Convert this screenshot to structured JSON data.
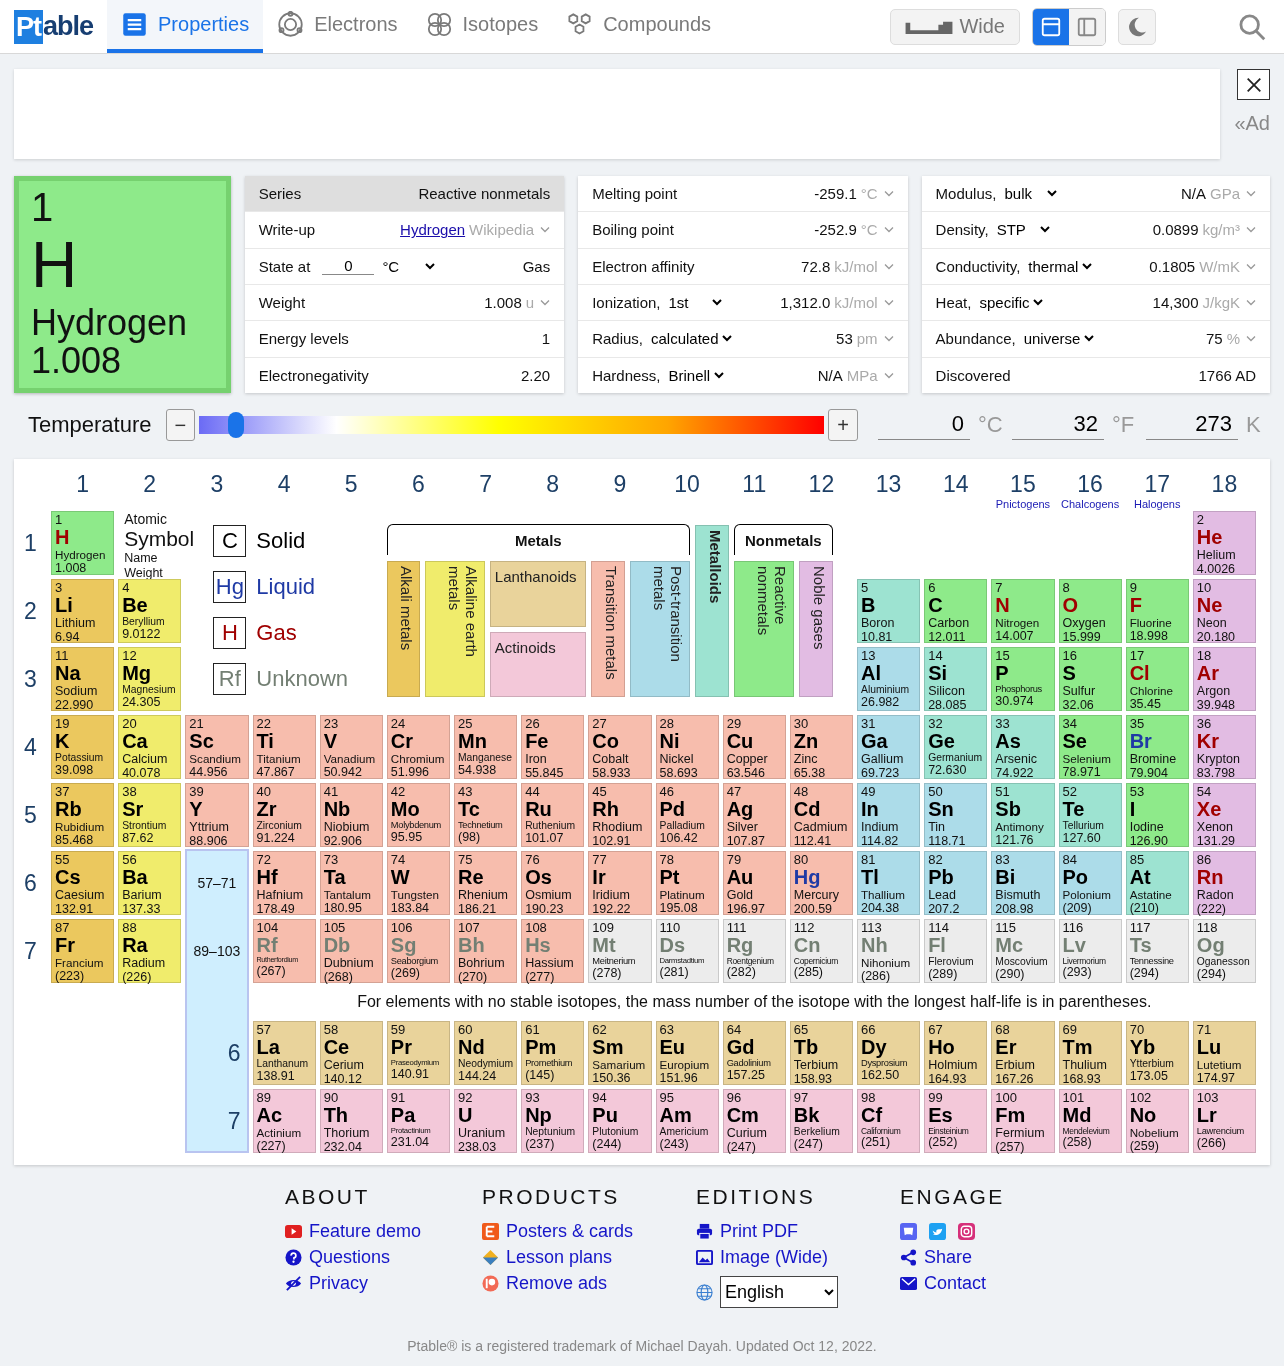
{
  "header": {
    "logo": {
      "mark": "Pt",
      "text": "able"
    },
    "tabs": [
      {
        "label": "Properties",
        "selected": true
      },
      {
        "label": "Electrons",
        "selected": false
      },
      {
        "label": "Isotopes",
        "selected": false
      },
      {
        "label": "Compounds",
        "selected": false
      }
    ],
    "wide_button": "Wide",
    "layouts": [
      {
        "selected": true
      },
      {
        "selected": false
      }
    ]
  },
  "ad": {
    "label": "«Ad"
  },
  "selected_element": {
    "number": "1",
    "symbol": "H",
    "name": "Hydrogen",
    "weight": "1.008",
    "kind": "reactive"
  },
  "property_tables": [
    {
      "rows": [
        {
          "label": "Series",
          "value": "Reactive nonmetals",
          "shaded": true,
          "menu": false
        },
        {
          "label": "Write-up",
          "link": "Hydrogen",
          "unit": "Wikipedia",
          "shaded": false,
          "menu": true
        },
        {
          "label": "State at",
          "input": "0",
          "select": "°C",
          "value": "Gas",
          "shaded": false,
          "menu": false
        },
        {
          "label": "Weight",
          "value": "1.008",
          "unit": "u",
          "shaded": false,
          "menu": true
        },
        {
          "label": "Energy levels",
          "value": "1",
          "shaded": false,
          "menu": false
        },
        {
          "label": "Electronegativity",
          "value": "2.20",
          "shaded": false,
          "menu": false
        }
      ]
    },
    {
      "rows": [
        {
          "label": "Melting point",
          "value": "-259.1",
          "unit": "°C",
          "shaded": false,
          "menu": true
        },
        {
          "label": "Boiling point",
          "value": "-252.9",
          "unit": "°C",
          "shaded": false,
          "menu": true
        },
        {
          "label": "Electron affinity",
          "value": "72.8",
          "unit": "kJ/mol",
          "shaded": false,
          "menu": true
        },
        {
          "label": "Ionization,",
          "select": "1st",
          "value": "1,312.0",
          "unit": "kJ/mol",
          "shaded": false,
          "menu": true
        },
        {
          "label": "Radius,",
          "select": "calculated",
          "value": "53",
          "unit": "pm",
          "shaded": false,
          "menu": true
        },
        {
          "label": "Hardness,",
          "select": "Brinell",
          "value": "N/A",
          "unit": "MPa",
          "shaded": false,
          "menu": true
        }
      ]
    },
    {
      "rows": [
        {
          "label": "Modulus,",
          "select": "bulk",
          "value": "N/A",
          "unit": "GPa",
          "shaded": false,
          "menu": true
        },
        {
          "label": "Density,",
          "select": "STP",
          "value": "0.0899",
          "unit": "kg/m³",
          "shaded": false,
          "menu": true
        },
        {
          "label": "Conductivity,",
          "select": "thermal",
          "value": "0.1805",
          "unit": "W/mK",
          "shaded": false,
          "menu": true
        },
        {
          "label": "Heat,",
          "select": "specific",
          "value": "14,300",
          "unit": "J/kgK",
          "shaded": false,
          "menu": true
        },
        {
          "label": "Abundance,",
          "select": "universe",
          "value": "75",
          "unit": "%",
          "shaded": false,
          "menu": true
        },
        {
          "label": "Discovered",
          "value": "1766 AD",
          "shaded": false,
          "menu": false
        }
      ]
    }
  ],
  "temperature": {
    "label": "Temperature",
    "minus": "−",
    "plus": "+",
    "level": 0.058,
    "readings": [
      {
        "value": "0",
        "unit": "°C"
      },
      {
        "value": "32",
        "unit": "°F"
      },
      {
        "value": "273",
        "unit": "K"
      }
    ]
  },
  "table": {
    "groups": [
      {
        "number": "1"
      },
      {
        "number": "2"
      },
      {
        "number": "3"
      },
      {
        "number": "4"
      },
      {
        "number": "5"
      },
      {
        "number": "6"
      },
      {
        "number": "7"
      },
      {
        "number": "8"
      },
      {
        "number": "9"
      },
      {
        "number": "10"
      },
      {
        "number": "11"
      },
      {
        "number": "12"
      },
      {
        "number": "13"
      },
      {
        "number": "14"
      },
      {
        "number": "15",
        "name": "Pnictogens"
      },
      {
        "number": "16",
        "name": "Chalcogens"
      },
      {
        "number": "17",
        "name": "Halogens"
      },
      {
        "number": "18"
      }
    ],
    "periods": [
      "1",
      "2",
      "3",
      "4",
      "5",
      "6",
      "7"
    ],
    "key": {
      "number": "Atomic",
      "symbol": "Symbol",
      "name": "Name",
      "weight": "Weight"
    },
    "states": [
      {
        "symbol": "C",
        "label": "Solid",
        "color": "#000000"
      },
      {
        "symbol": "Hg",
        "label": "Liquid",
        "color": "#1f3aa5"
      },
      {
        "symbol": "H",
        "label": "Gas",
        "color": "#a00000"
      },
      {
        "symbol": "Rf",
        "label": "Unknown",
        "color": "#737f73"
      }
    ],
    "legend": {
      "metals": {
        "label": "Metals",
        "categories": [
          {
            "kind": "alkali",
            "label": "Alkali metals"
          },
          {
            "kind": "alkaline",
            "label": "Alkaline earth metals"
          },
          {
            "kind": "stack",
            "items": [
              {
                "kind": "lanthanoid",
                "label": "Lanthanoids"
              },
              {
                "kind": "actinoid",
                "label": "Actinoids"
              }
            ]
          },
          {
            "kind": "transition",
            "label": "Transition metals"
          },
          {
            "kind": "post",
            "label": "Post-transition metals"
          }
        ]
      },
      "metalloids": {
        "kind": "metalloid",
        "label": "Metalloids"
      },
      "nonmetals": {
        "label": "Nonmetals",
        "categories": [
          {
            "kind": "reactive",
            "label": "Reactive nonmetals"
          },
          {
            "kind": "noble",
            "label": "Noble gases"
          }
        ]
      }
    },
    "f_block": {
      "ranges": [
        "57–71",
        "89–103"
      ],
      "periods": [
        "6",
        "7"
      ]
    },
    "note": "For elements with no stable isotopes, the mass number of the isotope with the longest half-life is in parentheses.",
    "elements": [
      {
        "number": "1",
        "symbol": "H",
        "name": "Hydrogen",
        "weight": "1.008",
        "kind": "reactive",
        "color": "#a00000"
      },
      {
        "number": "2",
        "symbol": "He",
        "name": "Helium",
        "weight": "4.0026",
        "kind": "noble",
        "color": "#a00000"
      },
      {
        "number": "3",
        "symbol": "Li",
        "name": "Lithium",
        "weight": "6.94",
        "kind": "alkali",
        "color": "#000000"
      },
      {
        "number": "4",
        "symbol": "Be",
        "name": "Beryllium",
        "weight": "9.0122",
        "kind": "alkaline",
        "color": "#000000"
      },
      {
        "number": "5",
        "symbol": "B",
        "name": "Boron",
        "weight": "10.81",
        "kind": "metalloid",
        "color": "#000000"
      },
      {
        "number": "6",
        "symbol": "C",
        "name": "Carbon",
        "weight": "12.011",
        "kind": "reactive",
        "color": "#000000"
      },
      {
        "number": "7",
        "symbol": "N",
        "name": "Nitrogen",
        "weight": "14.007",
        "kind": "reactive",
        "color": "#a00000"
      },
      {
        "number": "8",
        "symbol": "O",
        "name": "Oxygen",
        "weight": "15.999",
        "kind": "reactive",
        "color": "#a00000"
      },
      {
        "number": "9",
        "symbol": "F",
        "name": "Fluorine",
        "weight": "18.998",
        "kind": "reactive",
        "color": "#a00000"
      },
      {
        "number": "10",
        "symbol": "Ne",
        "name": "Neon",
        "weight": "20.180",
        "kind": "noble",
        "color": "#a00000"
      },
      {
        "number": "11",
        "symbol": "Na",
        "name": "Sodium",
        "weight": "22.990",
        "kind": "alkali",
        "color": "#000000"
      },
      {
        "number": "12",
        "symbol": "Mg",
        "name": "Magnesium",
        "weight": "24.305",
        "kind": "alkaline",
        "color": "#000000"
      },
      {
        "number": "13",
        "symbol": "Al",
        "name": "Aluminium",
        "weight": "26.982",
        "kind": "post",
        "color": "#000000"
      },
      {
        "number": "14",
        "symbol": "Si",
        "name": "Silicon",
        "weight": "28.085",
        "kind": "metalloid",
        "color": "#000000"
      },
      {
        "number": "15",
        "symbol": "P",
        "name": "Phosphorus",
        "weight": "30.974",
        "kind": "reactive",
        "color": "#000000"
      },
      {
        "number": "16",
        "symbol": "S",
        "name": "Sulfur",
        "weight": "32.06",
        "kind": "reactive",
        "color": "#000000"
      },
      {
        "number": "17",
        "symbol": "Cl",
        "name": "Chlorine",
        "weight": "35.45",
        "kind": "reactive",
        "color": "#a00000"
      },
      {
        "number": "18",
        "symbol": "Ar",
        "name": "Argon",
        "weight": "39.948",
        "kind": "noble",
        "color": "#a00000"
      },
      {
        "number": "19",
        "symbol": "K",
        "name": "Potassium",
        "weight": "39.098",
        "kind": "alkali",
        "color": "#000000"
      },
      {
        "number": "20",
        "symbol": "Ca",
        "name": "Calcium",
        "weight": "40.078",
        "kind": "alkaline",
        "color": "#000000"
      },
      {
        "number": "21",
        "symbol": "Sc",
        "name": "Scandium",
        "weight": "44.956",
        "kind": "transition",
        "color": "#000000"
      },
      {
        "number": "22",
        "symbol": "Ti",
        "name": "Titanium",
        "weight": "47.867",
        "kind": "transition",
        "color": "#000000"
      },
      {
        "number": "23",
        "symbol": "V",
        "name": "Vanadium",
        "weight": "50.942",
        "kind": "transition",
        "color": "#000000"
      },
      {
        "number": "24",
        "symbol": "Cr",
        "name": "Chromium",
        "weight": "51.996",
        "kind": "transition",
        "color": "#000000"
      },
      {
        "number": "25",
        "symbol": "Mn",
        "name": "Manganese",
        "weight": "54.938",
        "kind": "transition",
        "color": "#000000"
      },
      {
        "number": "26",
        "symbol": "Fe",
        "name": "Iron",
        "weight": "55.845",
        "kind": "transition",
        "color": "#000000"
      },
      {
        "number": "27",
        "symbol": "Co",
        "name": "Cobalt",
        "weight": "58.933",
        "kind": "transition",
        "color": "#000000"
      },
      {
        "number": "28",
        "symbol": "Ni",
        "name": "Nickel",
        "weight": "58.693",
        "kind": "transition",
        "color": "#000000"
      },
      {
        "number": "29",
        "symbol": "Cu",
        "name": "Copper",
        "weight": "63.546",
        "kind": "transition",
        "color": "#000000"
      },
      {
        "number": "30",
        "symbol": "Zn",
        "name": "Zinc",
        "weight": "65.38",
        "kind": "transition",
        "color": "#000000"
      },
      {
        "number": "31",
        "symbol": "Ga",
        "name": "Gallium",
        "weight": "69.723",
        "kind": "post",
        "color": "#000000"
      },
      {
        "number": "32",
        "symbol": "Ge",
        "name": "Germanium",
        "weight": "72.630",
        "kind": "metalloid",
        "color": "#000000"
      },
      {
        "number": "33",
        "symbol": "As",
        "name": "Arsenic",
        "weight": "74.922",
        "kind": "metalloid",
        "color": "#000000"
      },
      {
        "number": "34",
        "symbol": "Se",
        "name": "Selenium",
        "weight": "78.971",
        "kind": "reactive",
        "color": "#000000"
      },
      {
        "number": "35",
        "symbol": "Br",
        "name": "Bromine",
        "weight": "79.904",
        "kind": "reactive",
        "color": "#1f3aa5"
      },
      {
        "number": "36",
        "symbol": "Kr",
        "name": "Krypton",
        "weight": "83.798",
        "kind": "noble",
        "color": "#a00000"
      },
      {
        "number": "37",
        "symbol": "Rb",
        "name": "Rubidium",
        "weight": "85.468",
        "kind": "alkali",
        "color": "#000000"
      },
      {
        "number": "38",
        "symbol": "Sr",
        "name": "Strontium",
        "weight": "87.62",
        "kind": "alkaline",
        "color": "#000000"
      },
      {
        "number": "39",
        "symbol": "Y",
        "name": "Yttrium",
        "weight": "88.906",
        "kind": "transition",
        "color": "#000000"
      },
      {
        "number": "40",
        "symbol": "Zr",
        "name": "Zirconium",
        "weight": "91.224",
        "kind": "transition",
        "color": "#000000"
      },
      {
        "number": "41",
        "symbol": "Nb",
        "name": "Niobium",
        "weight": "92.906",
        "kind": "transition",
        "color": "#000000"
      },
      {
        "number": "42",
        "symbol": "Mo",
        "name": "Molybdenum",
        "weight": "95.95",
        "kind": "transition",
        "color": "#000000"
      },
      {
        "number": "43",
        "symbol": "Tc",
        "name": "Technetium",
        "weight": "(98)",
        "kind": "transition",
        "color": "#000000"
      },
      {
        "number": "44",
        "symbol": "Ru",
        "name": "Ruthenium",
        "weight": "101.07",
        "kind": "transition",
        "color": "#000000"
      },
      {
        "number": "45",
        "symbol": "Rh",
        "name": "Rhodium",
        "weight": "102.91",
        "kind": "transition",
        "color": "#000000"
      },
      {
        "number": "46",
        "symbol": "Pd",
        "name": "Palladium",
        "weight": "106.42",
        "kind": "transition",
        "color": "#000000"
      },
      {
        "number": "47",
        "symbol": "Ag",
        "name": "Silver",
        "weight": "107.87",
        "kind": "transition",
        "color": "#000000"
      },
      {
        "number": "48",
        "symbol": "Cd",
        "name": "Cadmium",
        "weight": "112.41",
        "kind": "transition",
        "color": "#000000"
      },
      {
        "number": "49",
        "symbol": "In",
        "name": "Indium",
        "weight": "114.82",
        "kind": "post",
        "color": "#000000"
      },
      {
        "number": "50",
        "symbol": "Sn",
        "name": "Tin",
        "weight": "118.71",
        "kind": "post",
        "color": "#000000"
      },
      {
        "number": "51",
        "symbol": "Sb",
        "name": "Antimony",
        "weight": "121.76",
        "kind": "metalloid",
        "color": "#000000"
      },
      {
        "number": "52",
        "symbol": "Te",
        "name": "Tellurium",
        "weight": "127.60",
        "kind": "metalloid",
        "color": "#000000"
      },
      {
        "number": "53",
        "symbol": "I",
        "name": "Iodine",
        "weight": "126.90",
        "kind": "reactive",
        "color": "#000000"
      },
      {
        "number": "54",
        "symbol": "Xe",
        "name": "Xenon",
        "weight": "131.29",
        "kind": "noble",
        "color": "#a00000"
      },
      {
        "number": "55",
        "symbol": "Cs",
        "name": "Caesium",
        "weight": "132.91",
        "kind": "alkali",
        "color": "#000000"
      },
      {
        "number": "56",
        "symbol": "Ba",
        "name": "Barium",
        "weight": "137.33",
        "kind": "alkaline",
        "color": "#000000"
      },
      {
        "number": "57",
        "symbol": "La",
        "name": "Lanthanum",
        "weight": "138.91",
        "kind": "lanthanoid",
        "color": "#000000"
      },
      {
        "number": "58",
        "symbol": "Ce",
        "name": "Cerium",
        "weight": "140.12",
        "kind": "lanthanoid",
        "color": "#000000"
      },
      {
        "number": "59",
        "symbol": "Pr",
        "name": "Praseodymium",
        "weight": "140.91",
        "kind": "lanthanoid",
        "color": "#000000"
      },
      {
        "number": "60",
        "symbol": "Nd",
        "name": "Neodymium",
        "weight": "144.24",
        "kind": "lanthanoid",
        "color": "#000000"
      },
      {
        "number": "61",
        "symbol": "Pm",
        "name": "Promethium",
        "weight": "(145)",
        "kind": "lanthanoid",
        "color": "#000000"
      },
      {
        "number": "62",
        "symbol": "Sm",
        "name": "Samarium",
        "weight": "150.36",
        "kind": "lanthanoid",
        "color": "#000000"
      },
      {
        "number": "63",
        "symbol": "Eu",
        "name": "Europium",
        "weight": "151.96",
        "kind": "lanthanoid",
        "color": "#000000"
      },
      {
        "number": "64",
        "symbol": "Gd",
        "name": "Gadolinium",
        "weight": "157.25",
        "kind": "lanthanoid",
        "color": "#000000"
      },
      {
        "number": "65",
        "symbol": "Tb",
        "name": "Terbium",
        "weight": "158.93",
        "kind": "lanthanoid",
        "color": "#000000"
      },
      {
        "number": "66",
        "symbol": "Dy",
        "name": "Dysprosium",
        "weight": "162.50",
        "kind": "lanthanoid",
        "color": "#000000"
      },
      {
        "number": "67",
        "symbol": "Ho",
        "name": "Holmium",
        "weight": "164.93",
        "kind": "lanthanoid",
        "color": "#000000"
      },
      {
        "number": "68",
        "symbol": "Er",
        "name": "Erbium",
        "weight": "167.26",
        "kind": "lanthanoid",
        "color": "#000000"
      },
      {
        "number": "69",
        "symbol": "Tm",
        "name": "Thulium",
        "weight": "168.93",
        "kind": "lanthanoid",
        "color": "#000000"
      },
      {
        "number": "70",
        "symbol": "Yb",
        "name": "Ytterbium",
        "weight": "173.05",
        "kind": "lanthanoid",
        "color": "#000000"
      },
      {
        "number": "71",
        "symbol": "Lu",
        "name": "Lutetium",
        "weight": "174.97",
        "kind": "lanthanoid",
        "color": "#000000"
      },
      {
        "number": "72",
        "symbol": "Hf",
        "name": "Hafnium",
        "weight": "178.49",
        "kind": "transition",
        "color": "#000000"
      },
      {
        "number": "73",
        "symbol": "Ta",
        "name": "Tantalum",
        "weight": "180.95",
        "kind": "transition",
        "color": "#000000"
      },
      {
        "number": "74",
        "symbol": "W",
        "name": "Tungsten",
        "weight": "183.84",
        "kind": "transition",
        "color": "#000000"
      },
      {
        "number": "75",
        "symbol": "Re",
        "name": "Rhenium",
        "weight": "186.21",
        "kind": "transition",
        "color": "#000000"
      },
      {
        "number": "76",
        "symbol": "Os",
        "name": "Osmium",
        "weight": "190.23",
        "kind": "transition",
        "color": "#000000"
      },
      {
        "number": "77",
        "symbol": "Ir",
        "name": "Iridium",
        "weight": "192.22",
        "kind": "transition",
        "color": "#000000"
      },
      {
        "number": "78",
        "symbol": "Pt",
        "name": "Platinum",
        "weight": "195.08",
        "kind": "transition",
        "color": "#000000"
      },
      {
        "number": "79",
        "symbol": "Au",
        "name": "Gold",
        "weight": "196.97",
        "kind": "transition",
        "color": "#000000"
      },
      {
        "number": "80",
        "symbol": "Hg",
        "name": "Mercury",
        "weight": "200.59",
        "kind": "transition",
        "color": "#1f3aa5"
      },
      {
        "number": "81",
        "symbol": "Tl",
        "name": "Thallium",
        "weight": "204.38",
        "kind": "post",
        "color": "#000000"
      },
      {
        "number": "82",
        "symbol": "Pb",
        "name": "Lead",
        "weight": "207.2",
        "kind": "post",
        "color": "#000000"
      },
      {
        "number": "83",
        "symbol": "Bi",
        "name": "Bismuth",
        "weight": "208.98",
        "kind": "post",
        "color": "#000000"
      },
      {
        "number": "84",
        "symbol": "Po",
        "name": "Polonium",
        "weight": "(209)",
        "kind": "post",
        "color": "#000000"
      },
      {
        "number": "85",
        "symbol": "At",
        "name": "Astatine",
        "weight": "(210)",
        "kind": "metalloid",
        "color": "#000000"
      },
      {
        "number": "86",
        "symbol": "Rn",
        "name": "Radon",
        "weight": "(222)",
        "kind": "noble",
        "color": "#a00000"
      },
      {
        "number": "87",
        "symbol": "Fr",
        "name": "Francium",
        "weight": "(223)",
        "kind": "alkali",
        "color": "#000000"
      },
      {
        "number": "88",
        "symbol": "Ra",
        "name": "Radium",
        "weight": "(226)",
        "kind": "alkaline",
        "color": "#000000"
      },
      {
        "number": "89",
        "symbol": "Ac",
        "name": "Actinium",
        "weight": "(227)",
        "kind": "actinoid",
        "color": "#000000"
      },
      {
        "number": "90",
        "symbol": "Th",
        "name": "Thorium",
        "weight": "232.04",
        "kind": "actinoid",
        "color": "#000000"
      },
      {
        "number": "91",
        "symbol": "Pa",
        "name": "Protactinium",
        "weight": "231.04",
        "kind": "actinoid",
        "color": "#000000"
      },
      {
        "number": "92",
        "symbol": "U",
        "name": "Uranium",
        "weight": "238.03",
        "kind": "actinoid",
        "color": "#000000"
      },
      {
        "number": "93",
        "symbol": "Np",
        "name": "Neptunium",
        "weight": "(237)",
        "kind": "actinoid",
        "color": "#000000"
      },
      {
        "number": "94",
        "symbol": "Pu",
        "name": "Plutonium",
        "weight": "(244)",
        "kind": "actinoid",
        "color": "#000000"
      },
      {
        "number": "95",
        "symbol": "Am",
        "name": "Americium",
        "weight": "(243)",
        "kind": "actinoid",
        "color": "#000000"
      },
      {
        "number": "96",
        "symbol": "Cm",
        "name": "Curium",
        "weight": "(247)",
        "kind": "actinoid",
        "color": "#000000"
      },
      {
        "number": "97",
        "symbol": "Bk",
        "name": "Berkelium",
        "weight": "(247)",
        "kind": "actinoid",
        "color": "#000000"
      },
      {
        "number": "98",
        "symbol": "Cf",
        "name": "Californium",
        "weight": "(251)",
        "kind": "actinoid",
        "color": "#000000"
      },
      {
        "number": "99",
        "symbol": "Es",
        "name": "Einsteinium",
        "weight": "(252)",
        "kind": "actinoid",
        "color": "#000000"
      },
      {
        "number": "100",
        "symbol": "Fm",
        "name": "Fermium",
        "weight": "(257)",
        "kind": "actinoid",
        "color": "#000000"
      },
      {
        "number": "101",
        "symbol": "Md",
        "name": "Mendelevium",
        "weight": "(258)",
        "kind": "actinoid",
        "color": "#000000"
      },
      {
        "number": "102",
        "symbol": "No",
        "name": "Nobelium",
        "weight": "(259)",
        "kind": "actinoid",
        "color": "#000000"
      },
      {
        "number": "103",
        "symbol": "Lr",
        "name": "Lawrencium",
        "weight": "(266)",
        "kind": "actinoid",
        "color": "#000000"
      },
      {
        "number": "104",
        "symbol": "Rf",
        "name": "Rutherfordium",
        "weight": "(267)",
        "kind": "transition",
        "color": "#737f73"
      },
      {
        "number": "105",
        "symbol": "Db",
        "name": "Dubnium",
        "weight": "(268)",
        "kind": "transition",
        "color": "#737f73"
      },
      {
        "number": "106",
        "symbol": "Sg",
        "name": "Seaborgium",
        "weight": "(269)",
        "kind": "transition",
        "color": "#737f73"
      },
      {
        "number": "107",
        "symbol": "Bh",
        "name": "Bohrium",
        "weight": "(270)",
        "kind": "transition",
        "color": "#737f73"
      },
      {
        "number": "108",
        "symbol": "Hs",
        "name": "Hassium",
        "weight": "(277)",
        "kind": "transition",
        "color": "#737f73"
      },
      {
        "number": "109",
        "symbol": "Mt",
        "name": "Meitnerium",
        "weight": "(278)",
        "kind": "unknown",
        "color": "#737f73"
      },
      {
        "number": "110",
        "symbol": "Ds",
        "name": "Darmstadtium",
        "weight": "(281)",
        "kind": "unknown",
        "color": "#737f73"
      },
      {
        "number": "111",
        "symbol": "Rg",
        "name": "Roentgenium",
        "weight": "(282)",
        "kind": "unknown",
        "color": "#737f73"
      },
      {
        "number": "112",
        "symbol": "Cn",
        "name": "Copernicium",
        "weight": "(285)",
        "kind": "unknown",
        "color": "#737f73"
      },
      {
        "number": "113",
        "symbol": "Nh",
        "name": "Nihonium",
        "weight": "(286)",
        "kind": "unknown",
        "color": "#737f73"
      },
      {
        "number": "114",
        "symbol": "Fl",
        "name": "Flerovium",
        "weight": "(289)",
        "kind": "unknown",
        "color": "#737f73"
      },
      {
        "number": "115",
        "symbol": "Mc",
        "name": "Moscovium",
        "weight": "(290)",
        "kind": "unknown",
        "color": "#737f73"
      },
      {
        "number": "116",
        "symbol": "Lv",
        "name": "Livermorium",
        "weight": "(293)",
        "kind": "unknown",
        "color": "#737f73"
      },
      {
        "number": "117",
        "symbol": "Ts",
        "name": "Tennessine",
        "weight": "(294)",
        "kind": "unknown",
        "color": "#737f73"
      },
      {
        "number": "118",
        "symbol": "Og",
        "name": "Oganesson",
        "weight": "(294)",
        "kind": "unknown",
        "color": "#737f73"
      }
    ]
  },
  "footer": {
    "sections": [
      {
        "title": "ABOUT",
        "kind": "links",
        "links": [
          "Feature demo",
          "Questions",
          "Privacy"
        ]
      },
      {
        "title": "PRODUCTS",
        "kind": "links",
        "links": [
          "Posters & cards",
          "Lesson plans",
          "Remove ads"
        ]
      },
      {
        "title": "EDITIONS",
        "kind": "links",
        "links": [
          "Print PDF",
          "Image (Wide)"
        ],
        "language": "English"
      },
      {
        "title": "ENGAGE",
        "kind": "social",
        "links": [
          "Share",
          "Contact"
        ]
      }
    ],
    "trademark": "Ptable® is a registered trademark of Michael Dayah. Updated Oct 12, 2022."
  }
}
